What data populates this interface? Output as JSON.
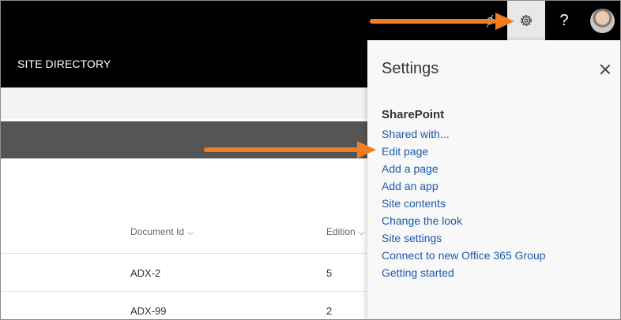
{
  "site": {
    "title": "SITE DIRECTORY"
  },
  "topbar": {
    "help_glyph": "?",
    "partial_icon_glyph": "ȼ"
  },
  "list": {
    "columns": [
      {
        "label": "Document Id",
        "chevron": "⌵"
      },
      {
        "label": "Edition",
        "chevron": "⌵"
      }
    ],
    "rows": [
      {
        "document_id": "ADX-2",
        "edition": "5"
      },
      {
        "document_id": "ADX-99",
        "edition": "2"
      }
    ]
  },
  "settings_panel": {
    "title": "Settings",
    "section": "SharePoint",
    "items": [
      "Shared with...",
      "Edit page",
      "Add a page",
      "Add an app",
      "Site contents",
      "Change the look",
      "Site settings",
      "Connect to new Office 365 Group",
      "Getting started"
    ]
  },
  "colors": {
    "suite_bar": "#000000",
    "link": "#1b5aa8",
    "annotation_arrow": "#f47c20"
  }
}
